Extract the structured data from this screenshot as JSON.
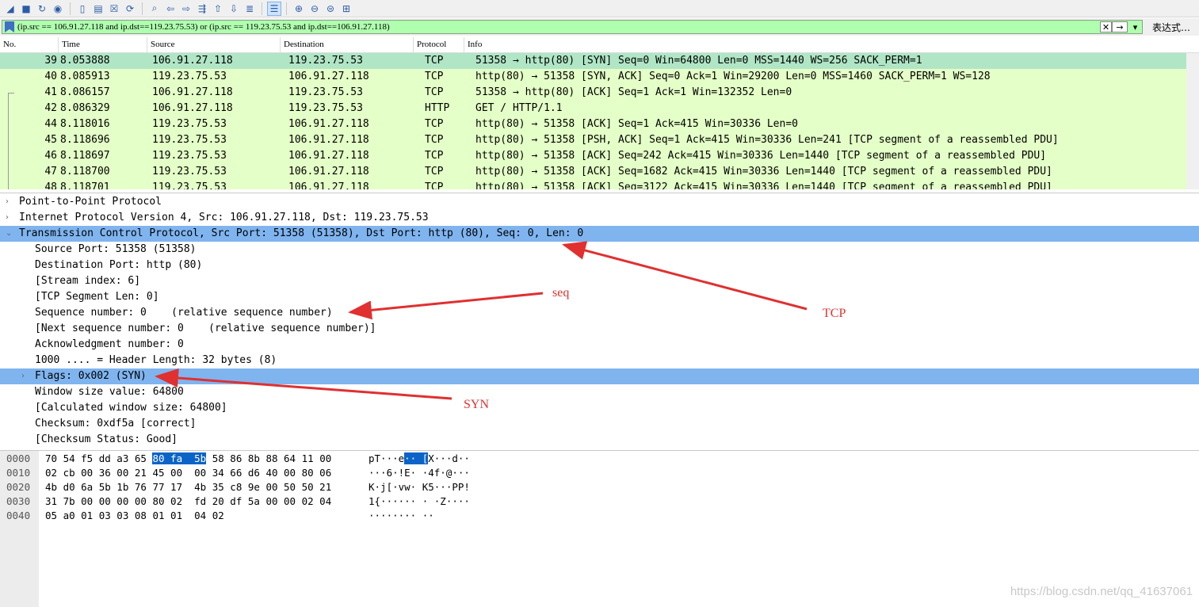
{
  "toolbar": {
    "icons": [
      "shark-fin-icon",
      "stop-icon",
      "restart-icon",
      "options-icon",
      "open-file-icon",
      "save-icon",
      "close-file-icon",
      "reload-icon",
      "find-icon",
      "go-back-icon",
      "go-forward-icon",
      "go-to-packet-icon",
      "first-packet-icon",
      "last-packet-icon",
      "autoscroll-icon",
      "colorize-icon",
      "zoom-in-icon",
      "zoom-out-icon",
      "zoom-normal-icon",
      "resize-columns-icon"
    ]
  },
  "filter": {
    "value": "(ip.src == 106.91.27.118 and ip.dst==119.23.75.53) or (ip.src == 119.23.75.53 and ip.dst==106.91.27.118)",
    "clear_glyph": "✕",
    "apply_glyph": "→",
    "dropdown_glyph": "▾",
    "expression_label": "表达式…"
  },
  "packet_list": {
    "columns": [
      "No.",
      "Time",
      "Source",
      "Destination",
      "Protocol",
      "Info"
    ],
    "rows": [
      {
        "no": "39",
        "time": "8.053888",
        "src": "106.91.27.118",
        "dst": "119.23.75.53",
        "proto": "TCP",
        "info": "51358 → http(80) [SYN] Seq=0 Win=64800 Len=0 MSS=1440 WS=256 SACK_PERM=1"
      },
      {
        "no": "40",
        "time": "8.085913",
        "src": "119.23.75.53",
        "dst": "106.91.27.118",
        "proto": "TCP",
        "info": "http(80) → 51358 [SYN, ACK] Seq=0 Ack=1 Win=29200 Len=0 MSS=1460 SACK_PERM=1 WS=128"
      },
      {
        "no": "41",
        "time": "8.086157",
        "src": "106.91.27.118",
        "dst": "119.23.75.53",
        "proto": "TCP",
        "info": "51358 → http(80) [ACK] Seq=1 Ack=1 Win=132352 Len=0"
      },
      {
        "no": "42",
        "time": "8.086329",
        "src": "106.91.27.118",
        "dst": "119.23.75.53",
        "proto": "HTTP",
        "info": "GET / HTTP/1.1"
      },
      {
        "no": "44",
        "time": "8.118016",
        "src": "119.23.75.53",
        "dst": "106.91.27.118",
        "proto": "TCP",
        "info": "http(80) → 51358 [ACK] Seq=1 Ack=415 Win=30336 Len=0"
      },
      {
        "no": "45",
        "time": "8.118696",
        "src": "119.23.75.53",
        "dst": "106.91.27.118",
        "proto": "TCP",
        "info": "http(80) → 51358 [PSH, ACK] Seq=1 Ack=415 Win=30336 Len=241 [TCP segment of a reassembled PDU]"
      },
      {
        "no": "46",
        "time": "8.118697",
        "src": "119.23.75.53",
        "dst": "106.91.27.118",
        "proto": "TCP",
        "info": "http(80) → 51358 [ACK] Seq=242 Ack=415 Win=30336 Len=1440 [TCP segment of a reassembled PDU]"
      },
      {
        "no": "47",
        "time": "8.118700",
        "src": "119.23.75.53",
        "dst": "106.91.27.118",
        "proto": "TCP",
        "info": "http(80) → 51358 [ACK] Seq=1682 Ack=415 Win=30336 Len=1440 [TCP segment of a reassembled PDU]"
      },
      {
        "no": "48",
        "time": "8.118701",
        "src": "119.23.75.53",
        "dst": "106.91.27.118",
        "proto": "TCP",
        "info": "http(80) → 51358 [ACK] Seq=3122 Ack=415 Win=30336 Len=1440 [TCP segment of a reassembled PDU]"
      }
    ]
  },
  "details": [
    {
      "text": "Point-to-Point Protocol",
      "indent": 0,
      "arrow": "›"
    },
    {
      "text": "Internet Protocol Version 4, Src: 106.91.27.118, Dst: 119.23.75.53",
      "indent": 0,
      "arrow": "›"
    },
    {
      "text": "Transmission Control Protocol, Src Port: 51358 (51358), Dst Port: http (80), Seq: 0, Len: 0",
      "indent": 0,
      "arrow": "⌄"
    },
    {
      "text": "Source Port: 51358 (51358)",
      "indent": 1,
      "arrow": ""
    },
    {
      "text": "Destination Port: http (80)",
      "indent": 1,
      "arrow": ""
    },
    {
      "text": "[Stream index: 6]",
      "indent": 1,
      "arrow": ""
    },
    {
      "text": "[TCP Segment Len: 0]",
      "indent": 1,
      "arrow": ""
    },
    {
      "text": "Sequence number: 0    (relative sequence number)",
      "indent": 1,
      "arrow": ""
    },
    {
      "text": "[Next sequence number: 0    (relative sequence number)]",
      "indent": 1,
      "arrow": ""
    },
    {
      "text": "Acknowledgment number: 0",
      "indent": 1,
      "arrow": ""
    },
    {
      "text": "1000 .... = Header Length: 32 bytes (8)",
      "indent": 1,
      "arrow": ""
    },
    {
      "text": "Flags: 0x002 (SYN)",
      "indent": 1,
      "arrow": "›"
    },
    {
      "text": "Window size value: 64800",
      "indent": 1,
      "arrow": ""
    },
    {
      "text": "[Calculated window size: 64800]",
      "indent": 1,
      "arrow": ""
    },
    {
      "text": "Checksum: 0xdf5a [correct]",
      "indent": 1,
      "arrow": ""
    },
    {
      "text": "[Checksum Status: Good]",
      "indent": 1,
      "arrow": ""
    }
  ],
  "bytes": [
    {
      "off": "0000",
      "hex_a": "70 54 f5 dd a3 65 ",
      "hex_hi": "80 fa  5b",
      "hex_b": " 58 86 8b 88 64 11 00",
      "asc_a": "pT···e",
      "asc_hi": "·· [",
      "asc_b": "X···d··"
    },
    {
      "off": "0010",
      "hex_a": "02 cb 00 36 00 21 45 00  00 34 66 d6 40 00 80 06",
      "hex_hi": "",
      "hex_b": "",
      "asc_a": "···6·!E· ·4f·@···",
      "asc_hi": "",
      "asc_b": ""
    },
    {
      "off": "0020",
      "hex_a": "4b d0 6a 5b 1b 76 77 17  4b 35 c8 9e 00 50 50 21",
      "hex_hi": "",
      "hex_b": "",
      "asc_a": "K·j[·vw· K5···PP!",
      "asc_hi": "",
      "asc_b": ""
    },
    {
      "off": "0030",
      "hex_a": "31 7b 00 00 00 00 80 02  fd 20 df 5a 00 00 02 04",
      "hex_hi": "",
      "hex_b": "",
      "asc_a": "1{······ · ·Z····",
      "asc_hi": "",
      "asc_b": ""
    },
    {
      "off": "0040",
      "hex_a": "05 a0 01 03 03 08 01 01  04 02",
      "hex_hi": "",
      "hex_b": "",
      "asc_a": "········ ··",
      "asc_hi": "",
      "asc_b": ""
    }
  ],
  "annotations": {
    "seq_label": "seq",
    "tcp_label": "TCP",
    "syn_label": "SYN",
    "color": "#e03030"
  },
  "watermark": "https://blog.csdn.net/qq_41637061",
  "colors": {
    "filter_bg": "#afffaf",
    "row_bg": "#e4ffc7",
    "row_selected": "#b0e6c6",
    "detail_highlight": "#7fb4ef",
    "byte_highlight": "#0a64c8"
  }
}
